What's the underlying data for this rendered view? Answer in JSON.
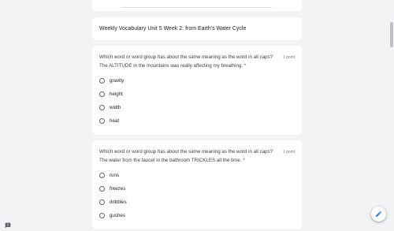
{
  "section": {
    "title": "Weekly Vocabulary Unit 5 Week 2: from Earth's Water Cycle"
  },
  "questions": [
    {
      "text": "Which word or word group has about the same meaning as the word in all caps? The ALTITUDE in the mountains was really affecting my breathing.",
      "required_mark": "*",
      "points": "1 point",
      "options": [
        "gravity",
        "height",
        "width",
        "heat"
      ]
    },
    {
      "text": "Which word or word group has about the same meaning as the word in all caps? The water from the faucet in the bathroom TRICKLES all the time.",
      "required_mark": "*",
      "points": "1 point",
      "options": [
        "runs",
        "freezes",
        "dribbles",
        "gushes"
      ]
    }
  ],
  "colors": {
    "page_background": "#f1f3f4",
    "card_background": "#ffffff",
    "required": "#d93025",
    "edit_icon": "#1a73e8"
  },
  "icons": {
    "edit": "pencil-icon",
    "feedback": "feedback-icon"
  }
}
